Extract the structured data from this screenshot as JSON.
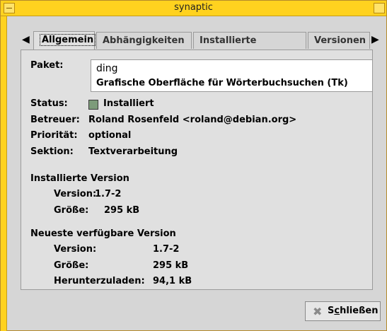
{
  "window": {
    "title": "synaptic"
  },
  "tabs": [
    "Allgemein",
    "Abhängigkeiten",
    "Installierte Dateien",
    "Versionen"
  ],
  "package": {
    "label": "Paket:",
    "name": "ding",
    "description": "Grafische Oberfläche für Wörterbuchsuchen (Tk)"
  },
  "fields": {
    "status_label": "Status:",
    "status_value": "Installiert",
    "maintainer_label": "Betreuer:",
    "maintainer_value": "Roland Rosenfeld <roland@debian.org>",
    "priority_label": "Priorität:",
    "priority_value": "optional",
    "section_label": "Sektion:",
    "section_value": "Textverarbeitung"
  },
  "installed": {
    "heading": "Installierte Version",
    "version_label": "Version:",
    "version_value": "1.7-2",
    "size_label": "Größe:",
    "size_value": "295 kB"
  },
  "latest": {
    "heading": "Neueste verfügbare Version",
    "version_label": "Version:",
    "version_value": "1.7-2",
    "size_label": "Größe:",
    "size_value": "295 kB",
    "download_label": "Herunterzuladen:",
    "download_value": "94,1 kB"
  },
  "close_button": {
    "pre": "S",
    "underlined": "c",
    "post": "hließen"
  },
  "colors": {
    "titlebar": "#ffd21f",
    "status_installed": "#7d9b7a"
  }
}
